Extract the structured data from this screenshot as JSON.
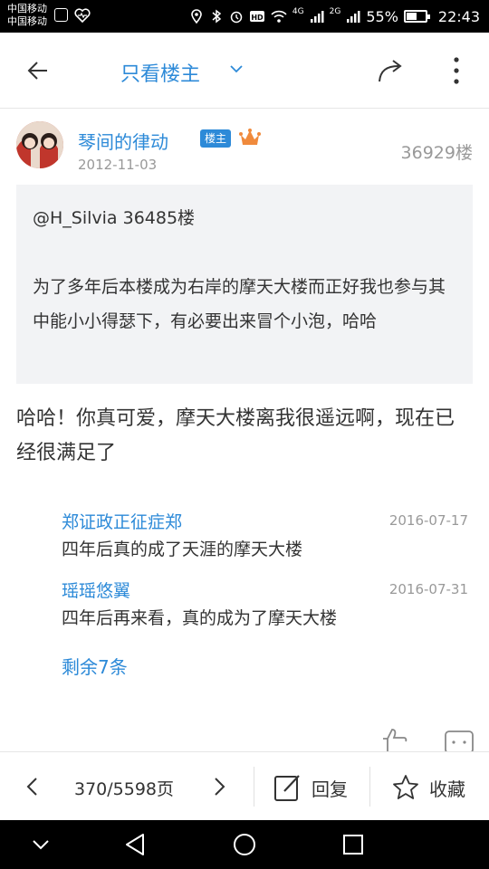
{
  "status_bar": {
    "carrier_1": "中国移动",
    "carrier_2": "中国移动",
    "network_1": "4G",
    "network_2": "2G",
    "battery": "55%",
    "battery_level": 0.55,
    "time": "22:43"
  },
  "topbar": {
    "title": "只看楼主",
    "accent": "#2d8ad8"
  },
  "post": {
    "author": "琴间的律动",
    "badge": "楼主",
    "date": "2012-11-03",
    "floor": "36929楼",
    "quote_at": "@H_Silvia 36485楼",
    "quote_body": "为了多年后本楼成为右岸的摩天大楼而正好我也参与其中能小小得瑟下，有必要出来冒个小泡，哈哈",
    "content": "哈哈！你真可爱，摩天大楼离我很遥远啊，现在已经很满足了"
  },
  "replies": [
    {
      "user": "郑证政正征症郑",
      "date": "2016-07-17",
      "text": "四年后真的成了天涯的摩天大楼"
    },
    {
      "user": "瑶瑶悠翼",
      "date": "2016-07-31",
      "text": "四年后再来看，真的成为了摩天大楼"
    }
  ],
  "more_replies": "剩余7条",
  "bottom_bar": {
    "page": "370/5598页",
    "reply_label": "回复",
    "favorite_label": "收藏"
  },
  "icons": [
    "back-arrow-icon",
    "chevron-down-icon",
    "share-icon",
    "more-vert-icon",
    "crown-icon",
    "like-icon",
    "comment-icon",
    "chevron-left-icon",
    "chevron-right-icon",
    "edit-icon",
    "star-icon",
    "nav-down-icon",
    "nav-back-icon",
    "nav-home-icon",
    "nav-recents-icon"
  ]
}
